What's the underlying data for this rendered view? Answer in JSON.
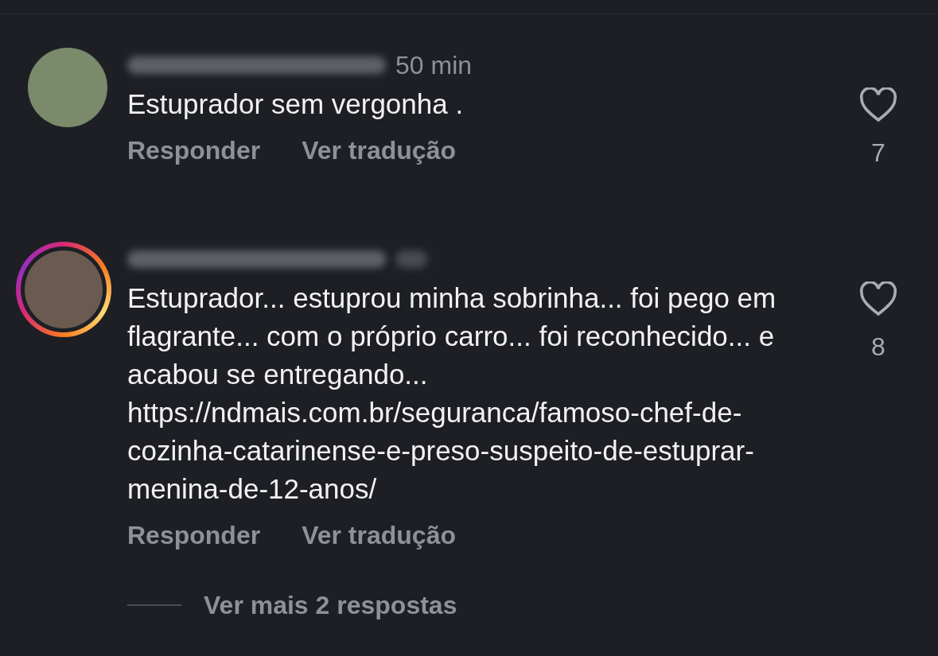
{
  "comments": [
    {
      "time": "50 min",
      "story_ring": false,
      "text": "Estuprador sem vergonha .",
      "actions": [
        "Responder",
        "Ver tradução"
      ],
      "liked": false,
      "likes": "7"
    },
    {
      "story_ring": true,
      "text": "Estuprador... estuprou minha sobrinha... foi pego em flagrante... com o próprio carro... foi reconhecido... e acabou se entregando... https://ndmais.com.br/seguranca/famoso-chef-de-cozinha-catarinense-e-preso-suspeito-de-estuprar-menina-de-12-anos/",
      "actions": [
        "Responder",
        "Ver tradução"
      ],
      "liked": false,
      "likes": "8"
    }
  ],
  "more_replies": "Ver mais 2 respostas"
}
